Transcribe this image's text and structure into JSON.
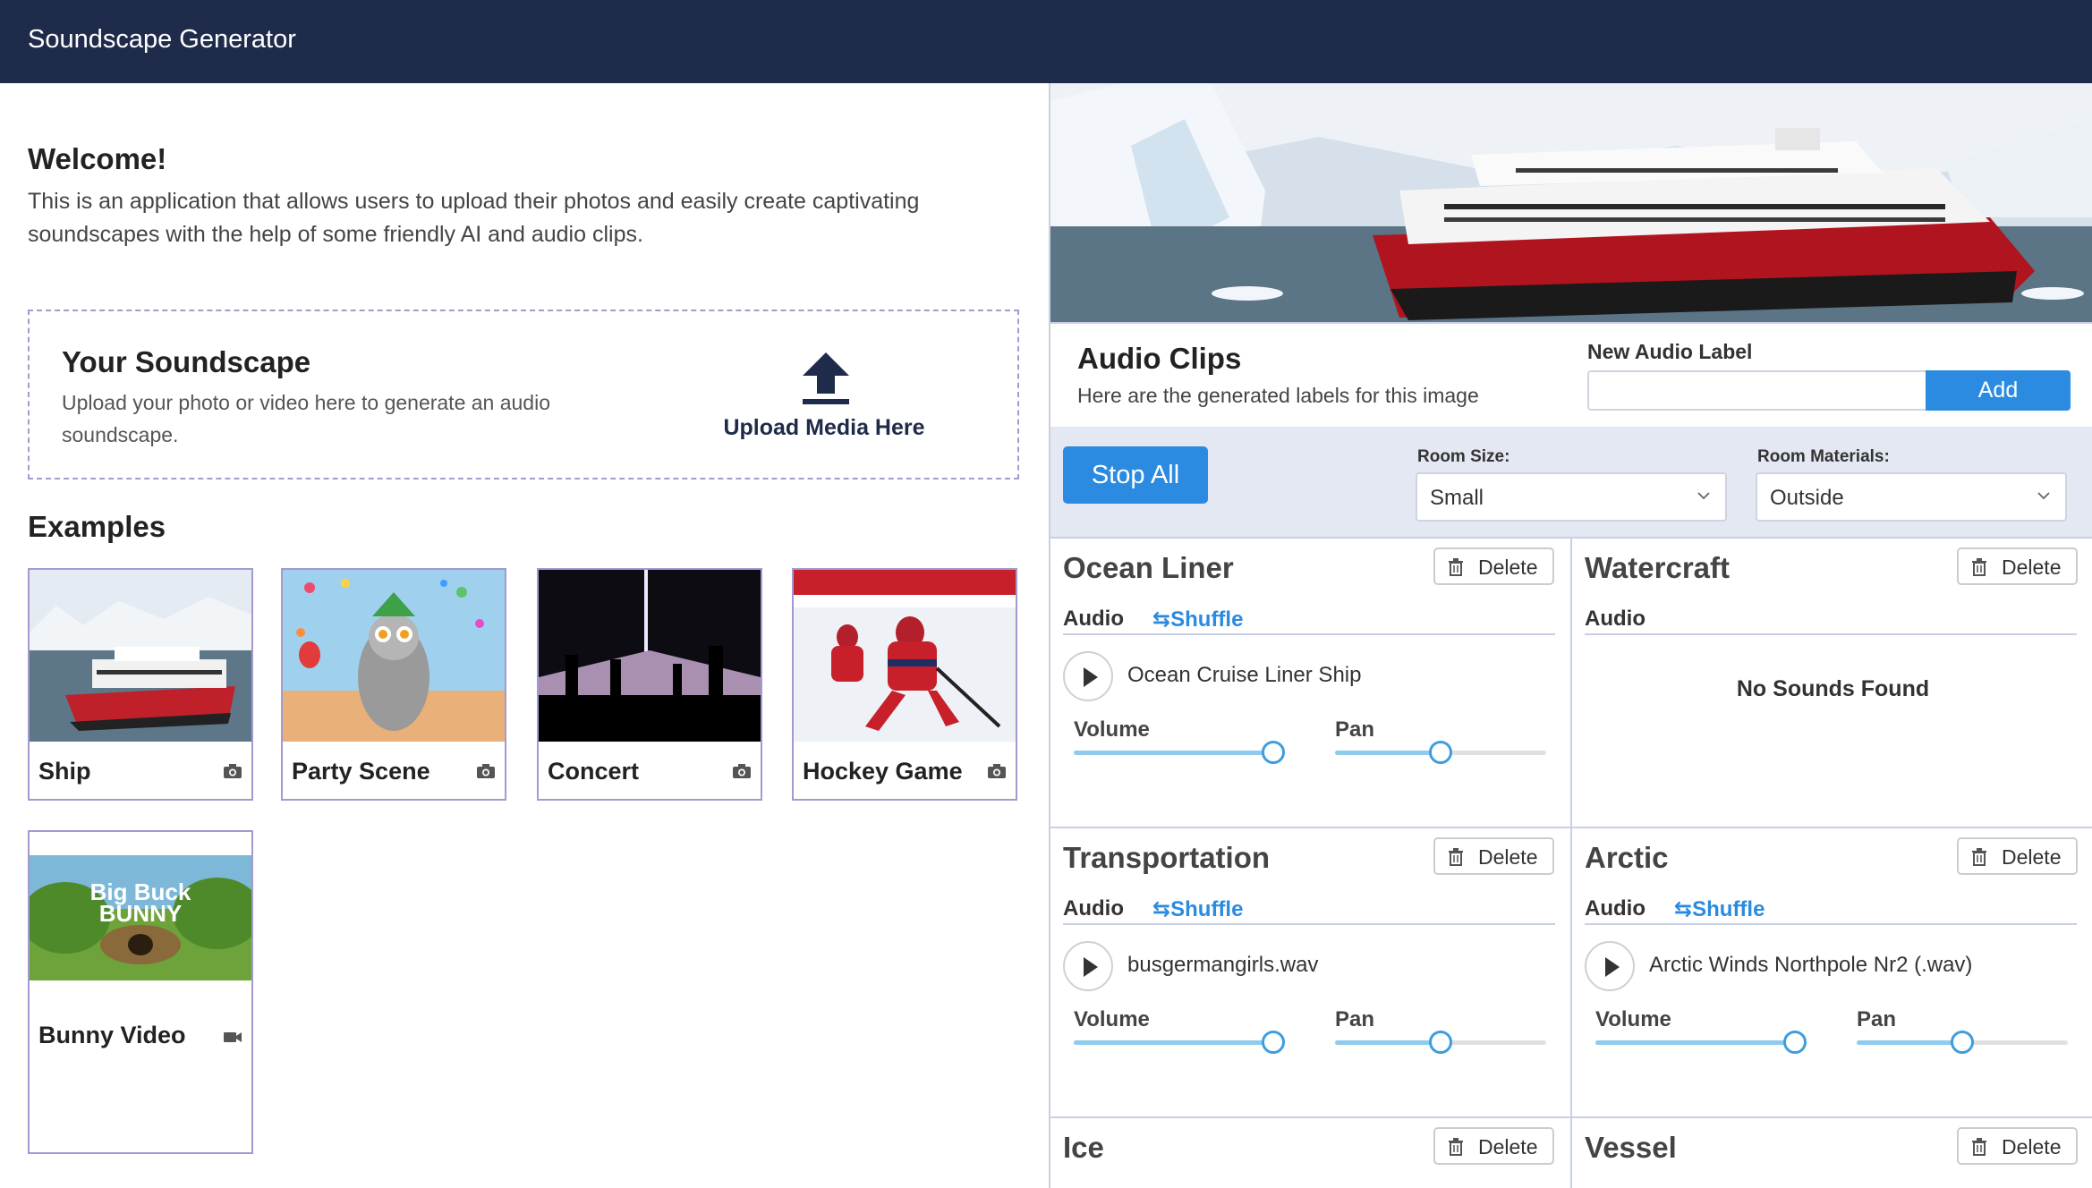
{
  "header": {
    "title": "Soundscape Generator"
  },
  "welcome": {
    "title": "Welcome!",
    "text": "This is an application that allows users to upload their photos and easily create captivating soundscapes with the help of some friendly AI and audio clips."
  },
  "upload": {
    "title": "Your Soundscape",
    "description": "Upload your photo or video here to generate an audio soundscape.",
    "button_label": "Upload Media Here"
  },
  "examples": {
    "title": "Examples",
    "items": [
      {
        "label": "Ship",
        "type_icon": "camera-icon"
      },
      {
        "label": "Party Scene",
        "type_icon": "camera-icon"
      },
      {
        "label": "Concert",
        "type_icon": "camera-icon"
      },
      {
        "label": "Hockey Game",
        "type_icon": "camera-icon"
      },
      {
        "label": "Bunny Video",
        "type_icon": "video-camera-icon"
      }
    ],
    "bunny_logo_line1": "Big Buck",
    "bunny_logo_line2": "BUNNY"
  },
  "audio_clips": {
    "title": "Audio Clips",
    "subtitle": "Here are the generated labels for this image",
    "new_label_title": "New Audio Label",
    "new_label_value": "",
    "add_label": "Add"
  },
  "controls": {
    "stop_all": "Stop All",
    "room_size_label": "Room Size:",
    "room_size_value": "Small",
    "room_materials_label": "Room Materials:",
    "room_materials_value": "Outside"
  },
  "clip_labels": {
    "delete": "Delete",
    "audio": "Audio",
    "shuffle": "⇆Shuffle",
    "volume": "Volume",
    "pan": "Pan",
    "no_sounds": "No Sounds Found"
  },
  "clips": [
    {
      "name": "Ocean Liner",
      "track": "Ocean Cruise Liner Ship",
      "volume": 1.0,
      "pan": 0.5
    },
    {
      "name": "Watercraft",
      "track": "",
      "no_sounds": true
    },
    {
      "name": "Transportation",
      "track": "busgermangirls.wav",
      "volume": 1.0,
      "pan": 0.5
    },
    {
      "name": "Arctic",
      "track": "Arctic Winds Northpole Nr2 (.wav)",
      "volume": 1.0,
      "pan": 0.5
    },
    {
      "name": "Ice"
    },
    {
      "name": "Vessel"
    }
  ],
  "colors": {
    "header_bg": "#1f2b4a",
    "accent": "#2a8be0",
    "card_border": "#a49ad0",
    "slider_fill": "#8ecbee"
  }
}
